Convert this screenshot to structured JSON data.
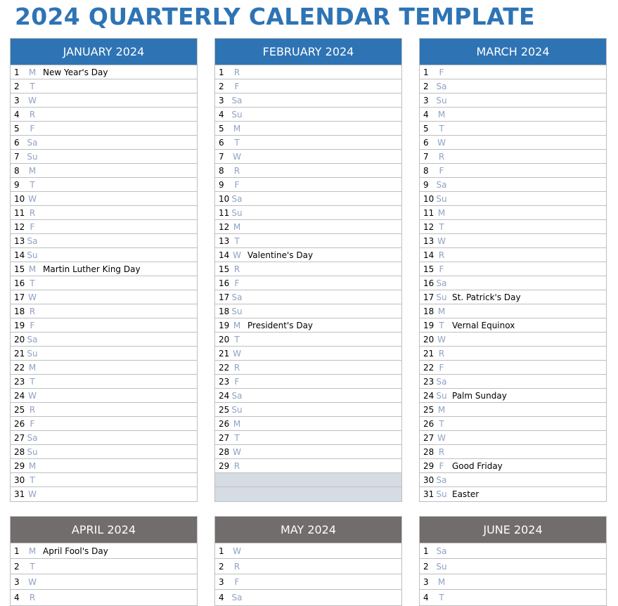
{
  "title": "2024 QUARTERLY CALENDAR TEMPLATE",
  "colors": {
    "title": "#2e74b5",
    "q1_header": "#2e74b5",
    "q2_header": "#716d6c",
    "day_letter": "#8ea2c4",
    "filler": "#d6dce4"
  },
  "months": [
    {
      "name": "JANUARY 2024",
      "days": [
        {
          "n": "1",
          "d": "M",
          "e": "New Year's Day"
        },
        {
          "n": "2",
          "d": "T",
          "e": ""
        },
        {
          "n": "3",
          "d": "W",
          "e": ""
        },
        {
          "n": "4",
          "d": "R",
          "e": ""
        },
        {
          "n": "5",
          "d": "F",
          "e": ""
        },
        {
          "n": "6",
          "d": "Sa",
          "e": ""
        },
        {
          "n": "7",
          "d": "Su",
          "e": ""
        },
        {
          "n": "8",
          "d": "M",
          "e": ""
        },
        {
          "n": "9",
          "d": "T",
          "e": ""
        },
        {
          "n": "10",
          "d": "W",
          "e": ""
        },
        {
          "n": "11",
          "d": "R",
          "e": ""
        },
        {
          "n": "12",
          "d": "F",
          "e": ""
        },
        {
          "n": "13",
          "d": "Sa",
          "e": ""
        },
        {
          "n": "14",
          "d": "Su",
          "e": ""
        },
        {
          "n": "15",
          "d": "M",
          "e": "Martin Luther King Day"
        },
        {
          "n": "16",
          "d": "T",
          "e": ""
        },
        {
          "n": "17",
          "d": "W",
          "e": ""
        },
        {
          "n": "18",
          "d": "R",
          "e": ""
        },
        {
          "n": "19",
          "d": "F",
          "e": ""
        },
        {
          "n": "20",
          "d": "Sa",
          "e": ""
        },
        {
          "n": "21",
          "d": "Su",
          "e": ""
        },
        {
          "n": "22",
          "d": "M",
          "e": ""
        },
        {
          "n": "23",
          "d": "T",
          "e": ""
        },
        {
          "n": "24",
          "d": "W",
          "e": ""
        },
        {
          "n": "25",
          "d": "R",
          "e": ""
        },
        {
          "n": "26",
          "d": "F",
          "e": ""
        },
        {
          "n": "27",
          "d": "Sa",
          "e": ""
        },
        {
          "n": "28",
          "d": "Su",
          "e": ""
        },
        {
          "n": "29",
          "d": "M",
          "e": ""
        },
        {
          "n": "30",
          "d": "T",
          "e": ""
        },
        {
          "n": "31",
          "d": "W",
          "e": ""
        }
      ]
    },
    {
      "name": "FEBRUARY 2024",
      "days": [
        {
          "n": "1",
          "d": "R",
          "e": ""
        },
        {
          "n": "2",
          "d": "F",
          "e": ""
        },
        {
          "n": "3",
          "d": "Sa",
          "e": ""
        },
        {
          "n": "4",
          "d": "Su",
          "e": ""
        },
        {
          "n": "5",
          "d": "M",
          "e": ""
        },
        {
          "n": "6",
          "d": "T",
          "e": ""
        },
        {
          "n": "7",
          "d": "W",
          "e": ""
        },
        {
          "n": "8",
          "d": "R",
          "e": ""
        },
        {
          "n": "9",
          "d": "F",
          "e": ""
        },
        {
          "n": "10",
          "d": "Sa",
          "e": ""
        },
        {
          "n": "11",
          "d": "Su",
          "e": ""
        },
        {
          "n": "12",
          "d": "M",
          "e": ""
        },
        {
          "n": "13",
          "d": "T",
          "e": ""
        },
        {
          "n": "14",
          "d": "W",
          "e": "Valentine's Day"
        },
        {
          "n": "15",
          "d": "R",
          "e": ""
        },
        {
          "n": "16",
          "d": "F",
          "e": ""
        },
        {
          "n": "17",
          "d": "Sa",
          "e": ""
        },
        {
          "n": "18",
          "d": "Su",
          "e": ""
        },
        {
          "n": "19",
          "d": "M",
          "e": "President's Day"
        },
        {
          "n": "20",
          "d": "T",
          "e": ""
        },
        {
          "n": "21",
          "d": "W",
          "e": ""
        },
        {
          "n": "22",
          "d": "R",
          "e": ""
        },
        {
          "n": "23",
          "d": "F",
          "e": ""
        },
        {
          "n": "24",
          "d": "Sa",
          "e": ""
        },
        {
          "n": "25",
          "d": "Su",
          "e": ""
        },
        {
          "n": "26",
          "d": "M",
          "e": ""
        },
        {
          "n": "27",
          "d": "T",
          "e": ""
        },
        {
          "n": "28",
          "d": "W",
          "e": ""
        },
        {
          "n": "29",
          "d": "R",
          "e": ""
        }
      ],
      "filler_rows": 2
    },
    {
      "name": "MARCH 2024",
      "days": [
        {
          "n": "1",
          "d": "F",
          "e": ""
        },
        {
          "n": "2",
          "d": "Sa",
          "e": ""
        },
        {
          "n": "3",
          "d": "Su",
          "e": ""
        },
        {
          "n": "4",
          "d": "M",
          "e": ""
        },
        {
          "n": "5",
          "d": "T",
          "e": ""
        },
        {
          "n": "6",
          "d": "W",
          "e": ""
        },
        {
          "n": "7",
          "d": "R",
          "e": ""
        },
        {
          "n": "8",
          "d": "F",
          "e": ""
        },
        {
          "n": "9",
          "d": "Sa",
          "e": ""
        },
        {
          "n": "10",
          "d": "Su",
          "e": ""
        },
        {
          "n": "11",
          "d": "M",
          "e": ""
        },
        {
          "n": "12",
          "d": "T",
          "e": ""
        },
        {
          "n": "13",
          "d": "W",
          "e": ""
        },
        {
          "n": "14",
          "d": "R",
          "e": ""
        },
        {
          "n": "15",
          "d": "F",
          "e": ""
        },
        {
          "n": "16",
          "d": "Sa",
          "e": ""
        },
        {
          "n": "17",
          "d": "Su",
          "e": "St. Patrick's Day"
        },
        {
          "n": "18",
          "d": "M",
          "e": ""
        },
        {
          "n": "19",
          "d": "T",
          "e": "Vernal Equinox"
        },
        {
          "n": "20",
          "d": "W",
          "e": ""
        },
        {
          "n": "21",
          "d": "R",
          "e": ""
        },
        {
          "n": "22",
          "d": "F",
          "e": ""
        },
        {
          "n": "23",
          "d": "Sa",
          "e": ""
        },
        {
          "n": "24",
          "d": "Su",
          "e": "Palm Sunday"
        },
        {
          "n": "25",
          "d": "M",
          "e": ""
        },
        {
          "n": "26",
          "d": "T",
          "e": ""
        },
        {
          "n": "27",
          "d": "W",
          "e": ""
        },
        {
          "n": "28",
          "d": "R",
          "e": ""
        },
        {
          "n": "29",
          "d": "F",
          "e": "Good Friday"
        },
        {
          "n": "30",
          "d": "Sa",
          "e": ""
        },
        {
          "n": "31",
          "d": "Su",
          "e": "Easter"
        }
      ]
    },
    {
      "name": "APRIL 2024",
      "days": [
        {
          "n": "1",
          "d": "M",
          "e": "April Fool's Day"
        },
        {
          "n": "2",
          "d": "T",
          "e": ""
        },
        {
          "n": "3",
          "d": "W",
          "e": ""
        },
        {
          "n": "4",
          "d": "R",
          "e": ""
        }
      ]
    },
    {
      "name": "MAY 2024",
      "days": [
        {
          "n": "1",
          "d": "W",
          "e": ""
        },
        {
          "n": "2",
          "d": "R",
          "e": ""
        },
        {
          "n": "3",
          "d": "F",
          "e": ""
        },
        {
          "n": "4",
          "d": "Sa",
          "e": ""
        }
      ]
    },
    {
      "name": "JUNE 2024",
      "days": [
        {
          "n": "1",
          "d": "Sa",
          "e": ""
        },
        {
          "n": "2",
          "d": "Su",
          "e": ""
        },
        {
          "n": "3",
          "d": "M",
          "e": ""
        },
        {
          "n": "4",
          "d": "T",
          "e": ""
        }
      ]
    }
  ]
}
